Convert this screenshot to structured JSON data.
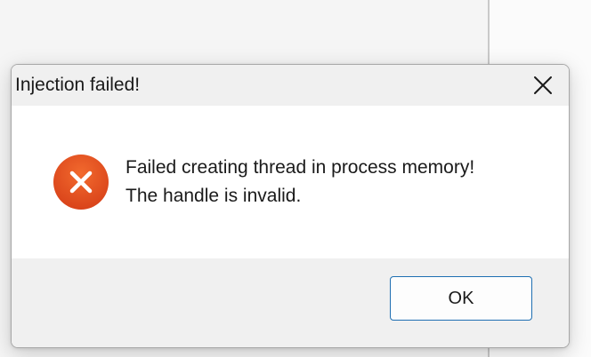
{
  "dialog": {
    "title": "Injection failed!",
    "close_icon": "close-icon",
    "error_icon": "error-icon",
    "message_line1": "Failed creating thread in process memory!",
    "message_line2": "The handle is invalid.",
    "ok_label": "OK"
  },
  "colors": {
    "error_icon_fill": "#e5541f",
    "button_border": "#1f6fb2",
    "titlebar_bg": "#f0f0f0"
  }
}
